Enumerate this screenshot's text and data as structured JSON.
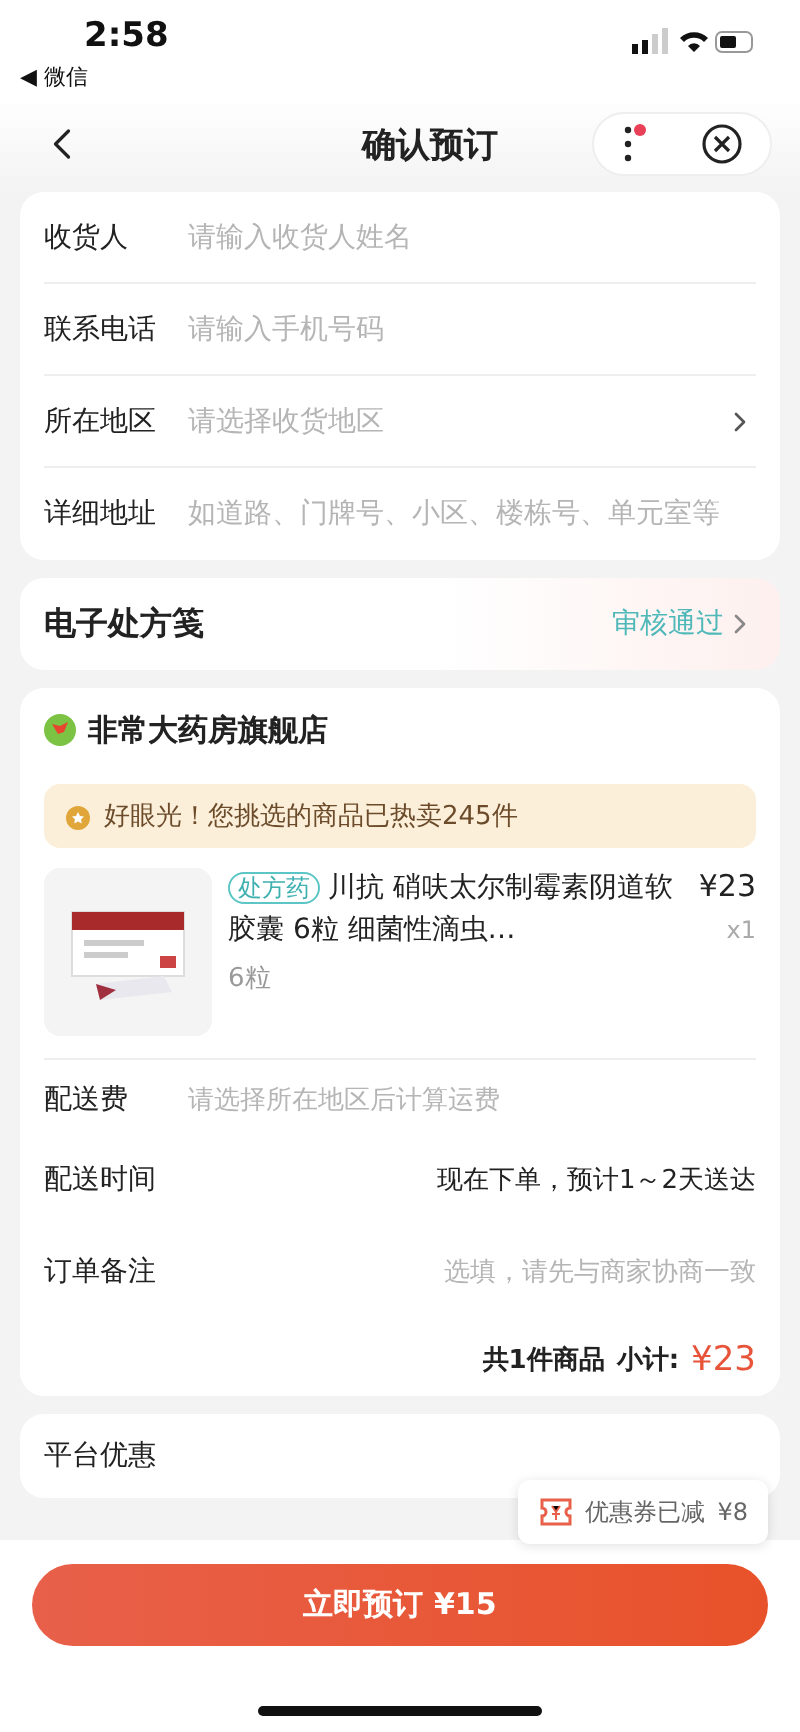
{
  "status_bar": {
    "time": "2:58",
    "back_app": "◀ 微信"
  },
  "nav": {
    "title": "确认预订"
  },
  "address_form": [
    {
      "label": "收货人",
      "placeholder": "请输入收货人姓名",
      "kind": "input"
    },
    {
      "label": "联系电话",
      "placeholder": "请输入手机号码",
      "kind": "input"
    },
    {
      "label": "所在地区",
      "placeholder": "请选择收货地区",
      "kind": "select"
    },
    {
      "label": "详细地址",
      "placeholder": "如道路、门牌号、小区、楼栋号、单元室等",
      "kind": "input"
    }
  ],
  "prescription": {
    "label": "电子处方笺",
    "status": "审核通过"
  },
  "store": {
    "name": "非常大药房旗舰店",
    "banner": "好眼光！您挑选的商品已热卖245件",
    "product": {
      "tag": "处方药",
      "title": "川抗 硝呋太尔制霉素阴道软胶囊 6粒 细菌性滴虫…",
      "spec": "6粒",
      "price": "¥23",
      "quantity": "x1"
    },
    "rows": [
      {
        "label": "配送费",
        "placeholder": "请选择所在地区后计算运费",
        "kind": "hint"
      },
      {
        "label": "配送时间",
        "value": "现在下单，预计1～2天送达",
        "kind": "value"
      },
      {
        "label": "订单备注",
        "placeholder": "选填，请先与商家协商一致",
        "kind": "input"
      }
    ],
    "summary": {
      "count": "共1件商品",
      "subtotal_label": "小计:",
      "subtotal": "¥23"
    }
  },
  "platform_discount": {
    "label": "平台优惠"
  },
  "coupon_tip": {
    "text": "优惠券已减",
    "amount": "¥8"
  },
  "submit": {
    "label": "立即预订",
    "amount": "¥15"
  }
}
